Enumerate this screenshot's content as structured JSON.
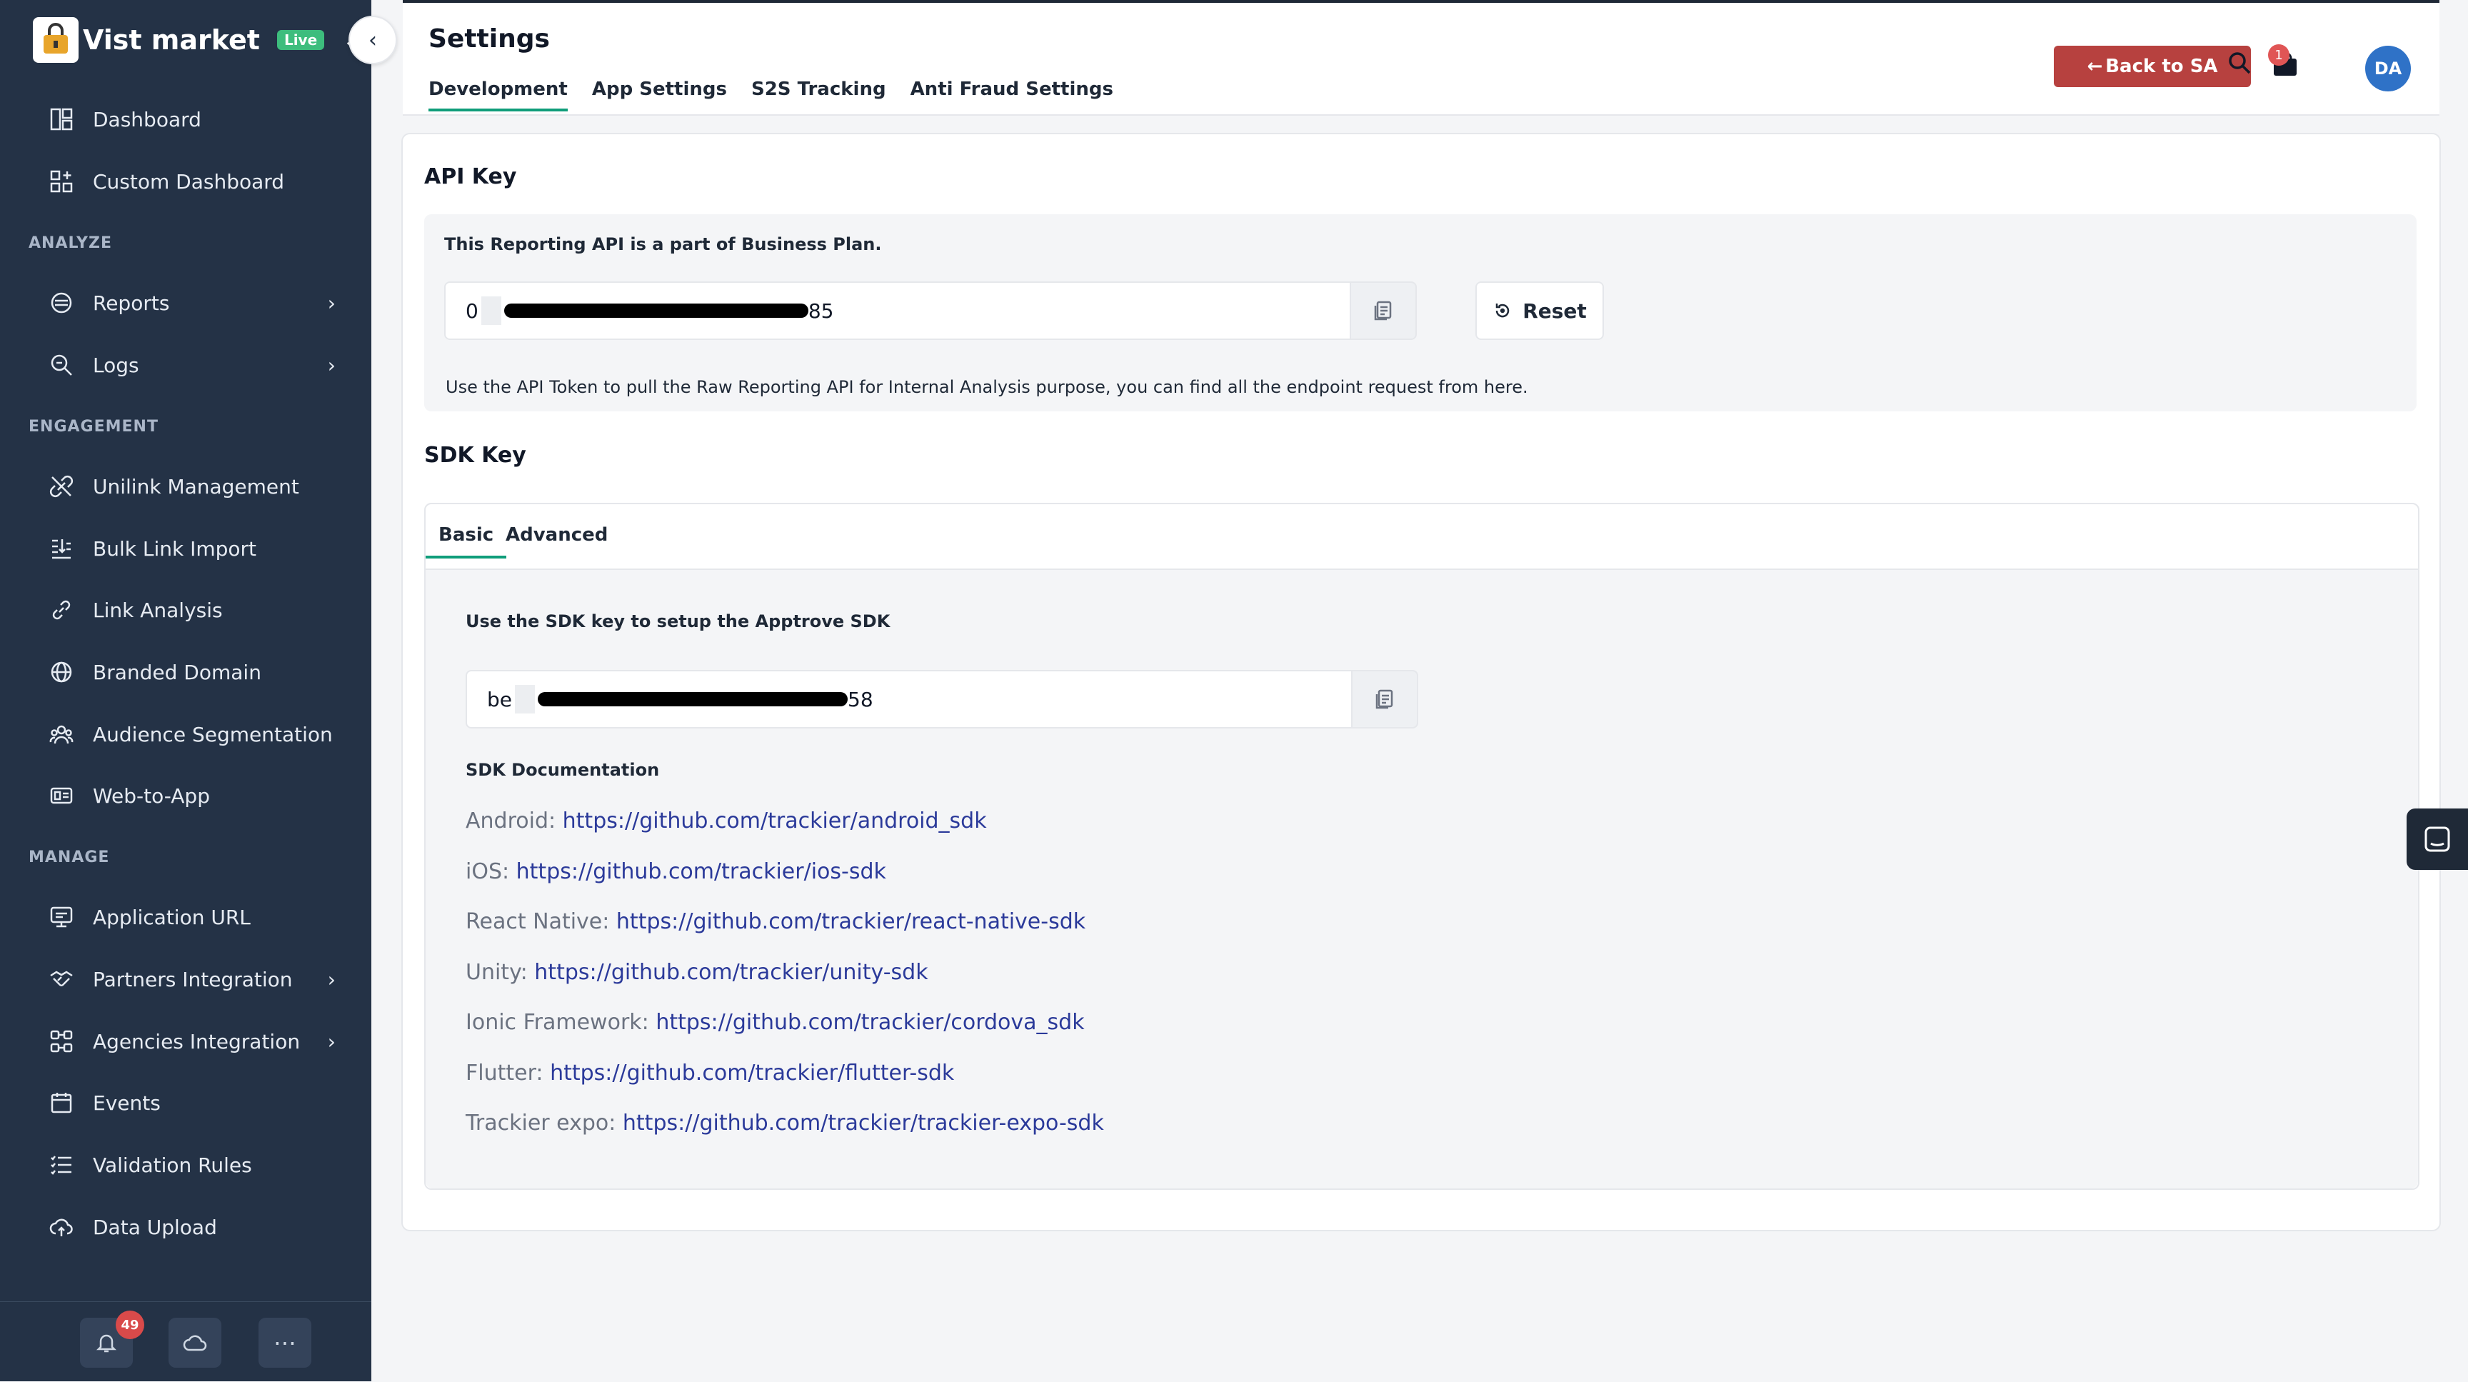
{
  "brand": {
    "name": "Vist market",
    "badge": "Live"
  },
  "sidebar": {
    "top_items": [
      {
        "label": "Dashboard",
        "icon": "dashboard-icon"
      },
      {
        "label": "Custom Dashboard",
        "icon": "custom-dashboard-icon"
      }
    ],
    "sections": {
      "analyze": "ANALYZE",
      "engagement": "ENGAGEMENT",
      "manage": "MANAGE"
    },
    "analyze_items": [
      {
        "label": "Reports",
        "icon": "reports-icon",
        "has_submenu": true
      },
      {
        "label": "Logs",
        "icon": "logs-icon",
        "has_submenu": true
      }
    ],
    "engagement_items": [
      {
        "label": "Unilink Management",
        "icon": "unilink-icon"
      },
      {
        "label": "Bulk Link Import",
        "icon": "bulk-import-icon"
      },
      {
        "label": "Link Analysis",
        "icon": "link-icon"
      },
      {
        "label": "Branded Domain",
        "icon": "globe-icon"
      },
      {
        "label": "Audience Segmentation",
        "icon": "audience-icon"
      },
      {
        "label": "Web-to-App",
        "icon": "web-to-app-icon"
      }
    ],
    "manage_items": [
      {
        "label": "Application URL",
        "icon": "application-url-icon"
      },
      {
        "label": "Partners Integration",
        "icon": "handshake-icon",
        "has_submenu": true
      },
      {
        "label": "Agencies Integration",
        "icon": "agencies-icon",
        "has_submenu": true
      },
      {
        "label": "Events",
        "icon": "calendar-icon"
      },
      {
        "label": "Validation Rules",
        "icon": "list-icon"
      },
      {
        "label": "Data Upload",
        "icon": "upload-cloud-icon"
      }
    ],
    "bottom": {
      "notification_count": "49"
    }
  },
  "header": {
    "title": "Settings",
    "tabs": [
      "Development",
      "App Settings",
      "S2S Tracking",
      "Anti Fraud Settings"
    ],
    "active_tab": "Development",
    "back_button": "Back to SA",
    "cart_count": "1",
    "avatar_initials": "DA"
  },
  "api_key": {
    "title": "API Key",
    "plan_note": "This Reporting API is a part of Business Plan.",
    "value_prefix": "0",
    "value_suffix": "85",
    "reset_label": "Reset",
    "help_text": "Use the API Token to pull the Raw Reporting API for Internal Analysis purpose, you can find all the endpoint request from here."
  },
  "sdk_key": {
    "title": "SDK Key",
    "tabs": [
      "Basic",
      "Advanced"
    ],
    "active_tab": "Basic",
    "instruction": "Use the SDK key to setup the Apptrove SDK",
    "value_prefix": "be",
    "value_suffix": "58",
    "docs_title": "SDK Documentation",
    "docs": [
      {
        "platform": "Android",
        "url": "https://github.com/trackier/android_sdk"
      },
      {
        "platform": "iOS",
        "url": "https://github.com/trackier/ios-sdk"
      },
      {
        "platform": "React Native",
        "url": "https://github.com/trackier/react-native-sdk"
      },
      {
        "platform": "Unity",
        "url": "https://github.com/trackier/unity-sdk"
      },
      {
        "platform": "Ionic Framework",
        "url": "https://github.com/trackier/cordova_sdk"
      },
      {
        "platform": "Flutter",
        "url": "https://github.com/trackier/flutter-sdk"
      },
      {
        "platform": "Trackier expo",
        "url": "https://github.com/trackier/trackier-expo-sdk"
      }
    ]
  },
  "colors": {
    "sidebar": "#243246",
    "accent": "#0f9d7a",
    "back_button": "#b7413f",
    "link": "#2b3a9a"
  }
}
